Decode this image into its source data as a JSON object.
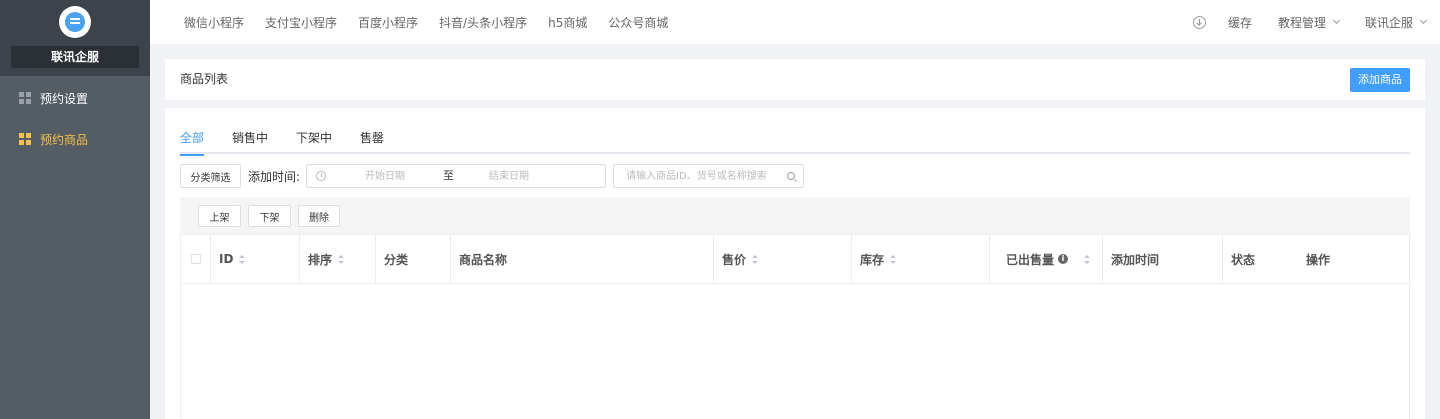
{
  "sidebar": {
    "brand": "联讯企服",
    "items": [
      {
        "label": "预约设置",
        "icon": "grid-icon",
        "active": false
      },
      {
        "label": "预约商品",
        "icon": "grid-icon",
        "active": true
      }
    ]
  },
  "header": {
    "nav": [
      "微信小程序",
      "支付宝小程序",
      "百度小程序",
      "抖音/头条小程序",
      "h5商城",
      "公众号商城"
    ],
    "right": {
      "download_icon": "download-icon",
      "cache": "缓存",
      "tutorial": "教程管理",
      "user": "联讯企服"
    }
  },
  "title_card": {
    "title": "商品列表",
    "add_button": "添加商品"
  },
  "tabs": [
    "全部",
    "销售中",
    "下架中",
    "售罄"
  ],
  "filters": {
    "category_button": "分类筛选",
    "time_label": "添加时间:",
    "start_placeholder": "开始日期",
    "separator": "至",
    "end_placeholder": "结束日期",
    "search_placeholder": "请输入商品ID、货号或名称搜索"
  },
  "bulk_actions": [
    "上架",
    "下架",
    "删除"
  ],
  "table": {
    "columns": {
      "id": "ID",
      "sort": "排序",
      "category": "分类",
      "name": "商品名称",
      "price": "售价",
      "stock": "库存",
      "sold": "已出售量",
      "added": "添加时间",
      "status": "状态",
      "actions": "操作"
    },
    "rows": []
  },
  "colors": {
    "sidebar_bg": "#545c64",
    "accent": "#409eff",
    "active_menu": "#f5c14b"
  }
}
